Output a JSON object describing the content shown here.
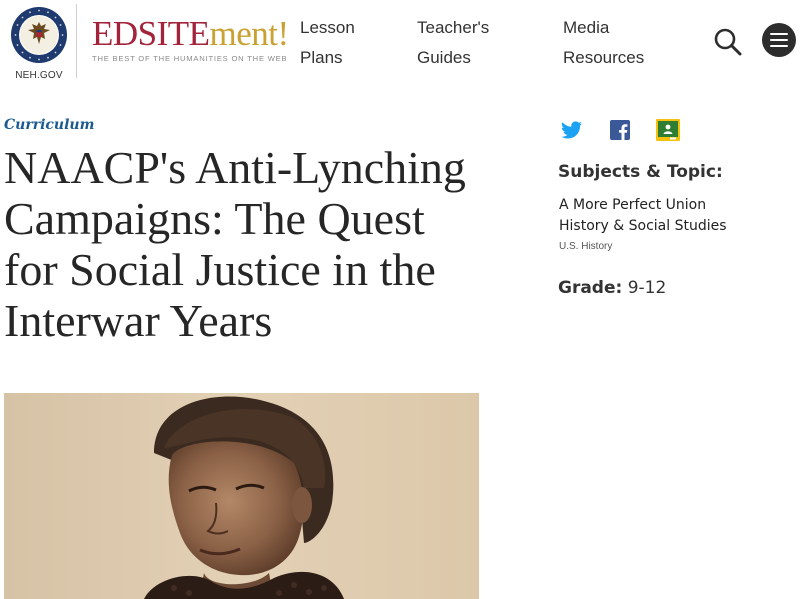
{
  "header": {
    "agency_label": "NEH.GOV",
    "brand": {
      "part1": "EDSITE",
      "part2": "ment!",
      "tagline": "THE BEST OF THE HUMANITIES ON THE WEB"
    },
    "nav": [
      {
        "line1": "Lesson",
        "line2": "Plans"
      },
      {
        "line1": "Teacher's",
        "line2": "Guides"
      },
      {
        "line1": "Media",
        "line2": "Resources"
      }
    ],
    "icons": {
      "search": "search-icon",
      "menu": "hamburger-menu-icon"
    }
  },
  "main": {
    "eyebrow": "Curriculum",
    "title": "NAACP's Anti-Lynching Campaigns: The Quest for Social Justice in the Interwar Years"
  },
  "sidebar": {
    "share": [
      "twitter-icon",
      "facebook-icon",
      "google-classroom-icon"
    ],
    "subjects_label": "Subjects & Topic:",
    "topics": [
      "A More Perfect Union",
      "History & Social Studies"
    ],
    "subtopic": "U.S. History",
    "grade_label": "Grade:",
    "grade_value": "9-12"
  },
  "colors": {
    "brand_red": "#a2233a",
    "brand_gold": "#c9a233",
    "link_blue": "#1a5a8f",
    "twitter": "#1da1f2",
    "facebook": "#3b5998",
    "classroom": "#2e7d32",
    "classroom_frame": "#f4c20d"
  }
}
